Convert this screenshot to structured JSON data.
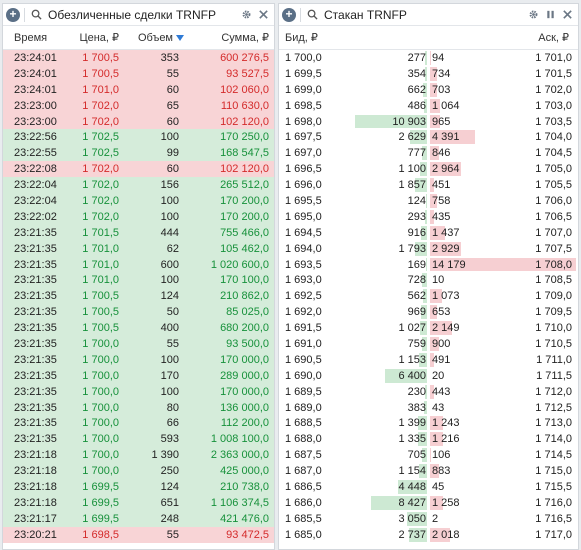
{
  "trades_panel": {
    "title": "Обезличенные сделки",
    "ticker": "TRNFP",
    "columns": {
      "time": "Время",
      "price": "Цена, ₽",
      "volume": "Объем",
      "sum": "Сумма, ₽"
    },
    "rows": [
      {
        "t": "23:24:01",
        "p": "1 700,5",
        "v": "353",
        "s": "600 276,5",
        "side": "sell"
      },
      {
        "t": "23:24:01",
        "p": "1 700,5",
        "v": "55",
        "s": "93 527,5",
        "side": "sell"
      },
      {
        "t": "23:24:01",
        "p": "1 701,0",
        "v": "60",
        "s": "102 060,0",
        "side": "sell"
      },
      {
        "t": "23:23:00",
        "p": "1 702,0",
        "v": "65",
        "s": "110 630,0",
        "side": "sell"
      },
      {
        "t": "23:23:00",
        "p": "1 702,0",
        "v": "60",
        "s": "102 120,0",
        "side": "sell"
      },
      {
        "t": "23:22:56",
        "p": "1 702,5",
        "v": "100",
        "s": "170 250,0",
        "side": "buy"
      },
      {
        "t": "23:22:55",
        "p": "1 702,5",
        "v": "99",
        "s": "168 547,5",
        "side": "buy"
      },
      {
        "t": "23:22:08",
        "p": "1 702,0",
        "v": "60",
        "s": "102 120,0",
        "side": "sell"
      },
      {
        "t": "23:22:04",
        "p": "1 702,0",
        "v": "156",
        "s": "265 512,0",
        "side": "buy"
      },
      {
        "t": "23:22:04",
        "p": "1 702,0",
        "v": "100",
        "s": "170 200,0",
        "side": "buy"
      },
      {
        "t": "23:22:02",
        "p": "1 702,0",
        "v": "100",
        "s": "170 200,0",
        "side": "buy"
      },
      {
        "t": "23:21:35",
        "p": "1 701,5",
        "v": "444",
        "s": "755 466,0",
        "side": "buy"
      },
      {
        "t": "23:21:35",
        "p": "1 701,0",
        "v": "62",
        "s": "105 462,0",
        "side": "buy"
      },
      {
        "t": "23:21:35",
        "p": "1 701,0",
        "v": "600",
        "s": "1 020 600,0",
        "side": "buy"
      },
      {
        "t": "23:21:35",
        "p": "1 701,0",
        "v": "100",
        "s": "170 100,0",
        "side": "buy"
      },
      {
        "t": "23:21:35",
        "p": "1 700,5",
        "v": "124",
        "s": "210 862,0",
        "side": "buy"
      },
      {
        "t": "23:21:35",
        "p": "1 700,5",
        "v": "50",
        "s": "85 025,0",
        "side": "buy"
      },
      {
        "t": "23:21:35",
        "p": "1 700,5",
        "v": "400",
        "s": "680 200,0",
        "side": "buy"
      },
      {
        "t": "23:21:35",
        "p": "1 700,0",
        "v": "55",
        "s": "93 500,0",
        "side": "buy"
      },
      {
        "t": "23:21:35",
        "p": "1 700,0",
        "v": "100",
        "s": "170 000,0",
        "side": "buy"
      },
      {
        "t": "23:21:35",
        "p": "1 700,0",
        "v": "170",
        "s": "289 000,0",
        "side": "buy"
      },
      {
        "t": "23:21:35",
        "p": "1 700,0",
        "v": "100",
        "s": "170 000,0",
        "side": "buy"
      },
      {
        "t": "23:21:35",
        "p": "1 700,0",
        "v": "80",
        "s": "136 000,0",
        "side": "buy"
      },
      {
        "t": "23:21:35",
        "p": "1 700,0",
        "v": "66",
        "s": "112 200,0",
        "side": "buy"
      },
      {
        "t": "23:21:35",
        "p": "1 700,0",
        "v": "593",
        "s": "1 008 100,0",
        "side": "buy"
      },
      {
        "t": "23:21:18",
        "p": "1 700,0",
        "v": "1 390",
        "s": "2 363 000,0",
        "side": "buy"
      },
      {
        "t": "23:21:18",
        "p": "1 700,0",
        "v": "250",
        "s": "425 000,0",
        "side": "buy"
      },
      {
        "t": "23:21:18",
        "p": "1 699,5",
        "v": "124",
        "s": "210 738,0",
        "side": "buy"
      },
      {
        "t": "23:21:18",
        "p": "1 699,5",
        "v": "651",
        "s": "1 106 374,5",
        "side": "buy"
      },
      {
        "t": "23:21:17",
        "p": "1 699,5",
        "v": "248",
        "s": "421 476,0",
        "side": "buy"
      },
      {
        "t": "23:20:21",
        "p": "1 698,5",
        "v": "55",
        "s": "93 472,5",
        "side": "sell"
      }
    ]
  },
  "book_panel": {
    "title": "Стакан",
    "ticker": "TRNFP",
    "columns": {
      "bid": "Бид, ₽",
      "ask": "Аск, ₽"
    },
    "rows": [
      {
        "bp": "1 700,0",
        "bv": "277",
        "av": "94",
        "ap": "1 701,0",
        "bb": 0.02,
        "ab": 0.01
      },
      {
        "bp": "1 699,5",
        "bv": "354",
        "av": "734",
        "ap": "1 701,5",
        "bb": 0.02,
        "ab": 0.05
      },
      {
        "bp": "1 699,0",
        "bv": "662",
        "av": "703",
        "ap": "1 702,0",
        "bb": 0.04,
        "ab": 0.05
      },
      {
        "bp": "1 698,5",
        "bv": "486",
        "av": "1 064",
        "ap": "1 703,0",
        "bb": 0.03,
        "ab": 0.07
      },
      {
        "bp": "1 698,0",
        "bv": "10 903",
        "av": "965",
        "ap": "1 703,5",
        "bb": 0.72,
        "ab": 0.07
      },
      {
        "bp": "1 697,5",
        "bv": "2 629",
        "av": "4 391",
        "ap": "1 704,0",
        "bb": 0.17,
        "ab": 0.31
      },
      {
        "bp": "1 697,0",
        "bv": "777",
        "av": "846",
        "ap": "1 704,5",
        "bb": 0.05,
        "ab": 0.06
      },
      {
        "bp": "1 696,5",
        "bv": "1 100",
        "av": "2 964",
        "ap": "1 705,0",
        "bb": 0.07,
        "ab": 0.21
      },
      {
        "bp": "1 696,0",
        "bv": "1 857",
        "av": "451",
        "ap": "1 705,5",
        "bb": 0.12,
        "ab": 0.03
      },
      {
        "bp": "1 695,5",
        "bv": "124",
        "av": "758",
        "ap": "1 706,0",
        "bb": 0.01,
        "ab": 0.05
      },
      {
        "bp": "1 695,0",
        "bv": "293",
        "av": "435",
        "ap": "1 706,5",
        "bb": 0.02,
        "ab": 0.03
      },
      {
        "bp": "1 694,5",
        "bv": "916",
        "av": "1 437",
        "ap": "1 707,0",
        "bb": 0.06,
        "ab": 0.1
      },
      {
        "bp": "1 694,0",
        "bv": "1 793",
        "av": "2 929",
        "ap": "1 707,5",
        "bb": 0.12,
        "ab": 0.21
      },
      {
        "bp": "1 693,5",
        "bv": "169",
        "av": "14 179",
        "ap": "1 708,0",
        "bb": 0.01,
        "ab": 1.0
      },
      {
        "bp": "1 693,0",
        "bv": "728",
        "av": "10",
        "ap": "1 708,5",
        "bb": 0.05,
        "ab": 0.0
      },
      {
        "bp": "1 692,5",
        "bv": "562",
        "av": "1 073",
        "ap": "1 709,0",
        "bb": 0.04,
        "ab": 0.08
      },
      {
        "bp": "1 692,0",
        "bv": "969",
        "av": "653",
        "ap": "1 709,5",
        "bb": 0.06,
        "ab": 0.05
      },
      {
        "bp": "1 691,5",
        "bv": "1 027",
        "av": "2 149",
        "ap": "1 710,0",
        "bb": 0.07,
        "ab": 0.15
      },
      {
        "bp": "1 691,0",
        "bv": "759",
        "av": "900",
        "ap": "1 710,5",
        "bb": 0.05,
        "ab": 0.06
      },
      {
        "bp": "1 690,5",
        "bv": "1 153",
        "av": "491",
        "ap": "1 711,0",
        "bb": 0.08,
        "ab": 0.03
      },
      {
        "bp": "1 690,0",
        "bv": "6 400",
        "av": "20",
        "ap": "1 711,5",
        "bb": 0.42,
        "ab": 0.0
      },
      {
        "bp": "1 689,5",
        "bv": "230",
        "av": "443",
        "ap": "1 712,0",
        "bb": 0.02,
        "ab": 0.03
      },
      {
        "bp": "1 689,0",
        "bv": "383",
        "av": "43",
        "ap": "1 712,5",
        "bb": 0.03,
        "ab": 0.0
      },
      {
        "bp": "1 688,5",
        "bv": "1 399",
        "av": "1 243",
        "ap": "1 713,0",
        "bb": 0.09,
        "ab": 0.09
      },
      {
        "bp": "1 688,0",
        "bv": "1 335",
        "av": "1 216",
        "ap": "1 714,0",
        "bb": 0.09,
        "ab": 0.09
      },
      {
        "bp": "1 687,5",
        "bv": "705",
        "av": "106",
        "ap": "1 714,5",
        "bb": 0.05,
        "ab": 0.01
      },
      {
        "bp": "1 687,0",
        "bv": "1 154",
        "av": "883",
        "ap": "1 715,0",
        "bb": 0.08,
        "ab": 0.06
      },
      {
        "bp": "1 686,5",
        "bv": "4 448",
        "av": "45",
        "ap": "1 715,5",
        "bb": 0.29,
        "ab": 0.0
      },
      {
        "bp": "1 686,0",
        "bv": "8 427",
        "av": "1 258",
        "ap": "1 716,0",
        "bb": 0.56,
        "ab": 0.09
      },
      {
        "bp": "1 685,5",
        "bv": "3 050",
        "av": "2",
        "ap": "1 716,5",
        "bb": 0.2,
        "ab": 0.0
      },
      {
        "bp": "1 685,0",
        "bv": "2 737",
        "av": "2 018",
        "ap": "1 717,0",
        "bb": 0.18,
        "ab": 0.14
      }
    ]
  },
  "icons": [
    "add-icon",
    "search-icon",
    "gear-icon",
    "close-icon",
    "pause-icon",
    "sort-arrow-icon"
  ]
}
